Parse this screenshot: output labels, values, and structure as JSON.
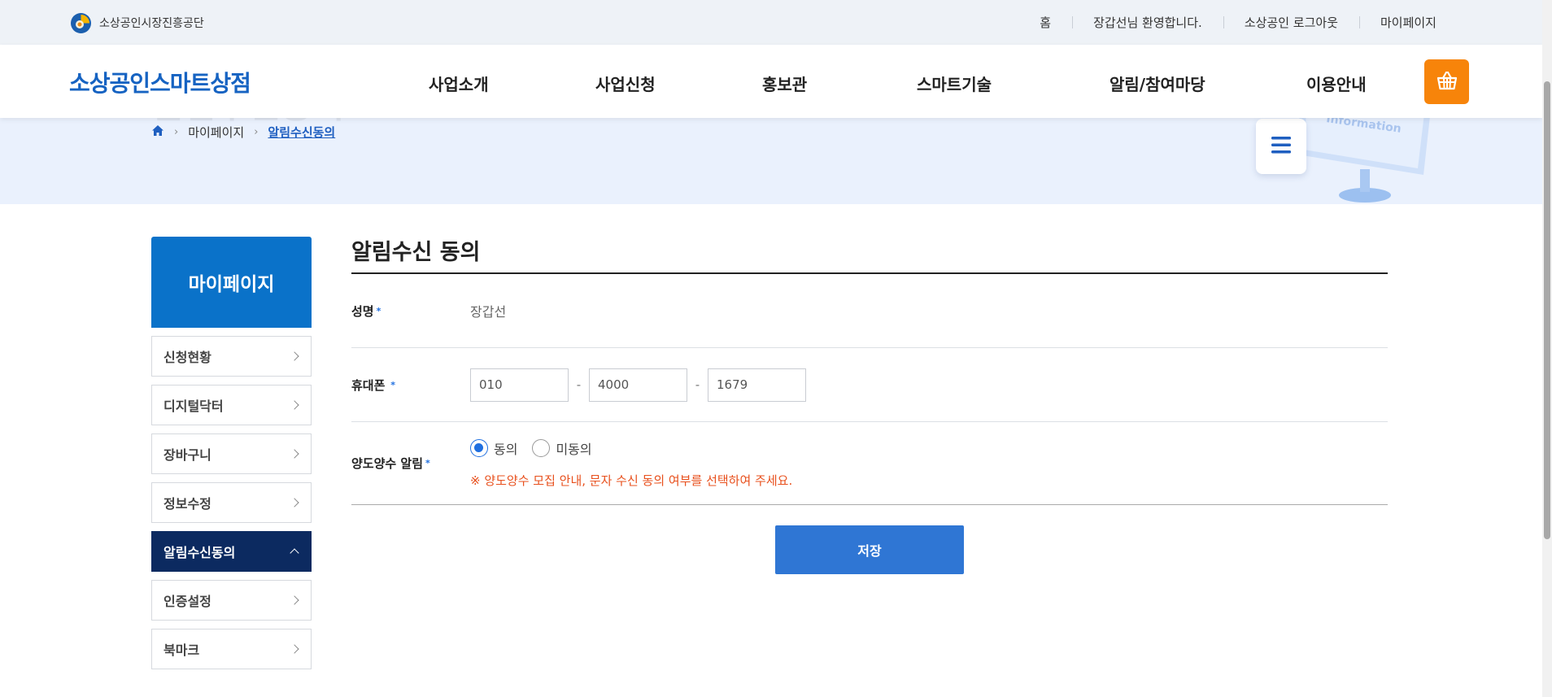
{
  "org": {
    "name": "소상공인시장진흥공단",
    "logo_icon": "org-logo-icon"
  },
  "util_links": [
    "홈",
    "장갑선님 환영합니다.",
    "소상공인 로그아웃",
    "마이페이지"
  ],
  "brand": "소상공인스마트상점",
  "gnb": [
    "사업소개",
    "사업신청",
    "홍보관",
    "스마트기술",
    "알림/참여마당",
    "이용안내"
  ],
  "cart_icon": "basket-icon",
  "sub_visual": {
    "ghost_title": "알림수신동의",
    "breadcrumb": [
      "마이페이지",
      "알림수신동의"
    ],
    "monitor_text": "Information"
  },
  "lnb": {
    "title": "마이페이지",
    "items": [
      {
        "label": "신청현황",
        "active": false
      },
      {
        "label": "디지털닥터",
        "active": false
      },
      {
        "label": "장바구니",
        "active": false
      },
      {
        "label": "정보수정",
        "active": false
      },
      {
        "label": "알림수신동의",
        "active": true
      },
      {
        "label": "인증설정",
        "active": false
      },
      {
        "label": "북마크",
        "active": false
      }
    ]
  },
  "form": {
    "title": "알림수신 동의",
    "name_label": "성명",
    "name_value": "장갑선",
    "phone_label": "휴대폰",
    "phone": [
      "010",
      "4000",
      "1679"
    ],
    "alert_label": "양도양수 알림",
    "radio_agree": "동의",
    "radio_disagree": "미동의",
    "selected": "동의",
    "notice": "※ 양도양수 모집 안내, 문자 수신 동의 여부를 선택하여 주세요.",
    "save_label": "저장"
  },
  "colors": {
    "brand_blue": "#1663c2",
    "lnb_head": "#0a72c9",
    "lnb_active": "#0c2a60",
    "cart": "#f7840a",
    "save": "#2f76d4",
    "notice": "#e8501d"
  }
}
